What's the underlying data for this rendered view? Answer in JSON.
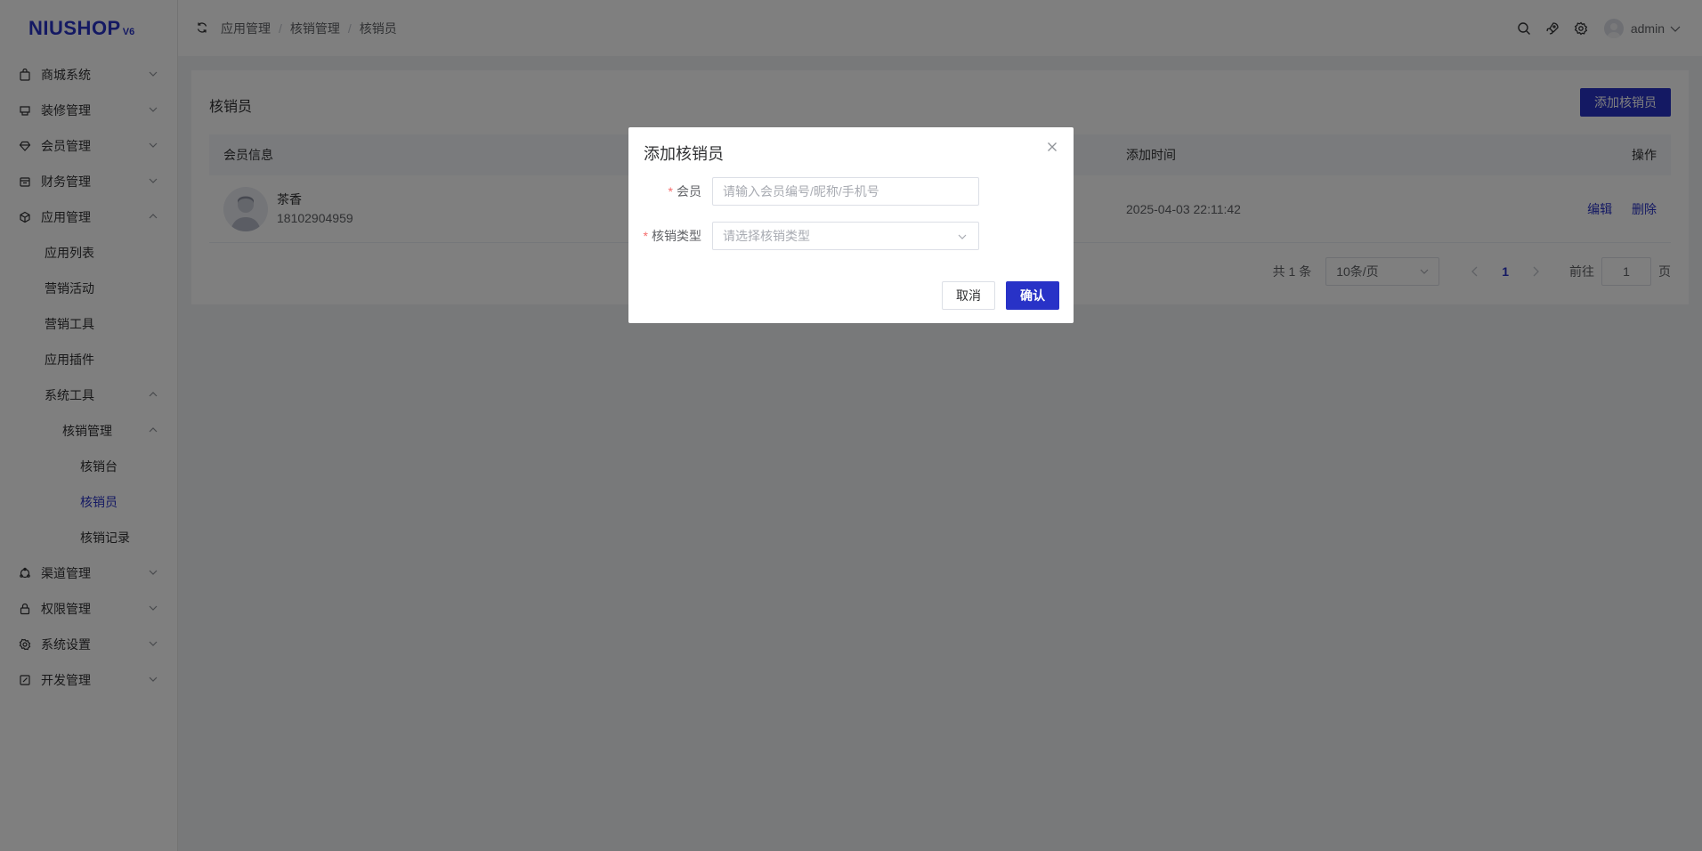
{
  "brand": {
    "logo_text": "NIUSHOP",
    "version": "V6",
    "accent_color": "#2832c7"
  },
  "sidebar": {
    "items": [
      {
        "label": "商城系统",
        "icon": "bag-icon",
        "expanded": false
      },
      {
        "label": "装修管理",
        "icon": "decorate-icon",
        "expanded": false
      },
      {
        "label": "会员管理",
        "icon": "diamond-icon",
        "expanded": false
      },
      {
        "label": "财务管理",
        "icon": "wallet-icon",
        "expanded": false
      },
      {
        "label": "应用管理",
        "icon": "cube-icon",
        "expanded": true
      },
      {
        "label": "应用列表"
      },
      {
        "label": "营销活动"
      },
      {
        "label": "营销工具"
      },
      {
        "label": "应用插件"
      },
      {
        "label": "系统工具",
        "expanded": true
      },
      {
        "label": "核销管理",
        "expanded": true
      },
      {
        "label": "核销台"
      },
      {
        "label": "核销员",
        "active": true
      },
      {
        "label": "核销记录"
      },
      {
        "label": "渠道管理",
        "icon": "channel-icon",
        "expanded": false
      },
      {
        "label": "权限管理",
        "icon": "lock-icon",
        "expanded": false
      },
      {
        "label": "系统设置",
        "icon": "gear-icon",
        "expanded": false
      },
      {
        "label": "开发管理",
        "icon": "edit-icon",
        "expanded": false
      }
    ]
  },
  "header": {
    "breadcrumb": [
      "应用管理",
      "核销管理",
      "核销员"
    ],
    "separator": "/",
    "user_name": "admin"
  },
  "main": {
    "title": "核销员",
    "add_button": "添加核销员",
    "columns": {
      "member": "会员信息",
      "time": "添加时间",
      "op": "操作"
    },
    "rows": [
      {
        "name": "茶香",
        "phone": "18102904959",
        "time": "2025-04-03 22:11:42",
        "edit": "编辑",
        "delete": "删除"
      }
    ],
    "pager": {
      "total": "共 1 条",
      "page_size": "10条/页",
      "current": "1",
      "goto_label": "前往",
      "goto_value": "1",
      "page_suffix": "页"
    }
  },
  "dialog": {
    "title": "添加核销员",
    "member_label": "会员",
    "member_placeholder": "请输入会员编号/昵称/手机号",
    "type_label": "核销类型",
    "type_placeholder": "请选择核销类型",
    "required_mark": "*",
    "cancel": "取消",
    "confirm": "确认"
  }
}
